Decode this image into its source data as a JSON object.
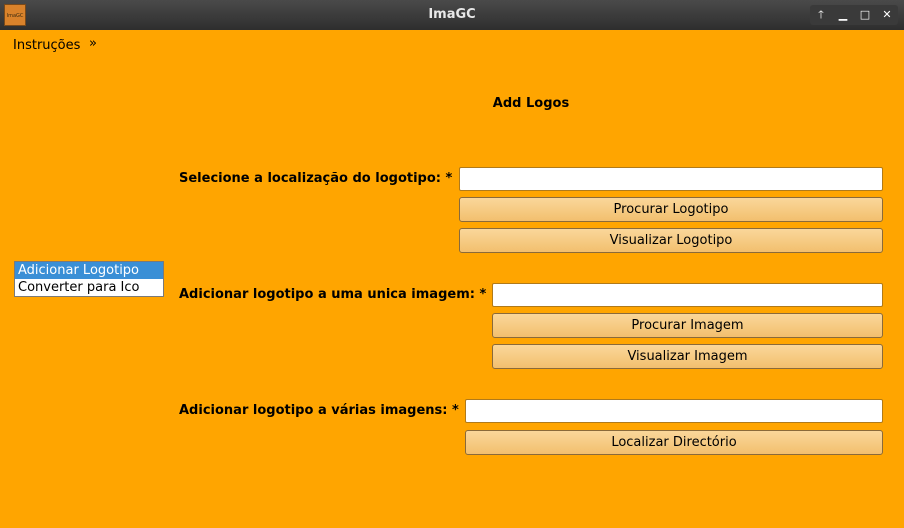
{
  "window": {
    "title": "ImaGC",
    "app_icon_text": "ImaGC",
    "controls": {
      "up": "🡑",
      "minimize": "▁",
      "maximize": "□",
      "close": "✕"
    }
  },
  "menubar": {
    "instrucoes": "Instruções",
    "more": "»"
  },
  "heading": "Add Logos",
  "sidebar": {
    "items": [
      {
        "label": "Adicionar Logotipo",
        "selected": true
      },
      {
        "label": "Converter para Ico",
        "selected": false
      }
    ]
  },
  "logo_section": {
    "label": "Selecione a localização do logotipo: *",
    "value": "",
    "browse_button": "Procurar Logotipo",
    "preview_button": "Visualizar Logotipo"
  },
  "single_image_section": {
    "label": "Adicionar logotipo a uma unica imagem: *",
    "value": "",
    "browse_button": "Procurar Imagem",
    "preview_button": "Visualizar Imagem"
  },
  "multi_image_section": {
    "label": "Adicionar logotipo a várias imagens: *",
    "value": "",
    "directory_button": "Localizar Directório"
  }
}
